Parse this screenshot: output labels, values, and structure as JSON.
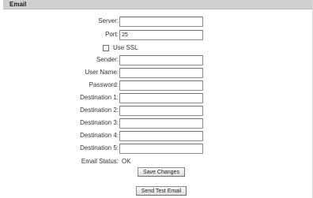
{
  "section": {
    "title": "Email"
  },
  "form": {
    "server": {
      "label": "Server:",
      "value": ""
    },
    "port": {
      "label": "Port:",
      "value": "25"
    },
    "ssl": {
      "label": "Use SSL",
      "checked": false
    },
    "sender": {
      "label": "Sender:",
      "value": ""
    },
    "user_name": {
      "label": "User Name:",
      "value": ""
    },
    "password": {
      "label": "Password:",
      "value": ""
    },
    "destination_1": {
      "label": "Destination 1:",
      "value": ""
    },
    "destination_2": {
      "label": "Destination 2:",
      "value": ""
    },
    "destination_3": {
      "label": "Destination 3:",
      "value": ""
    },
    "destination_4": {
      "label": "Destination 4:",
      "value": ""
    },
    "destination_5": {
      "label": "Destination 5:",
      "value": ""
    },
    "email_status": {
      "label": "Email Status:",
      "value": "OK"
    }
  },
  "actions": {
    "save_label": "Save Changes",
    "test_label": "Send Test Email"
  }
}
